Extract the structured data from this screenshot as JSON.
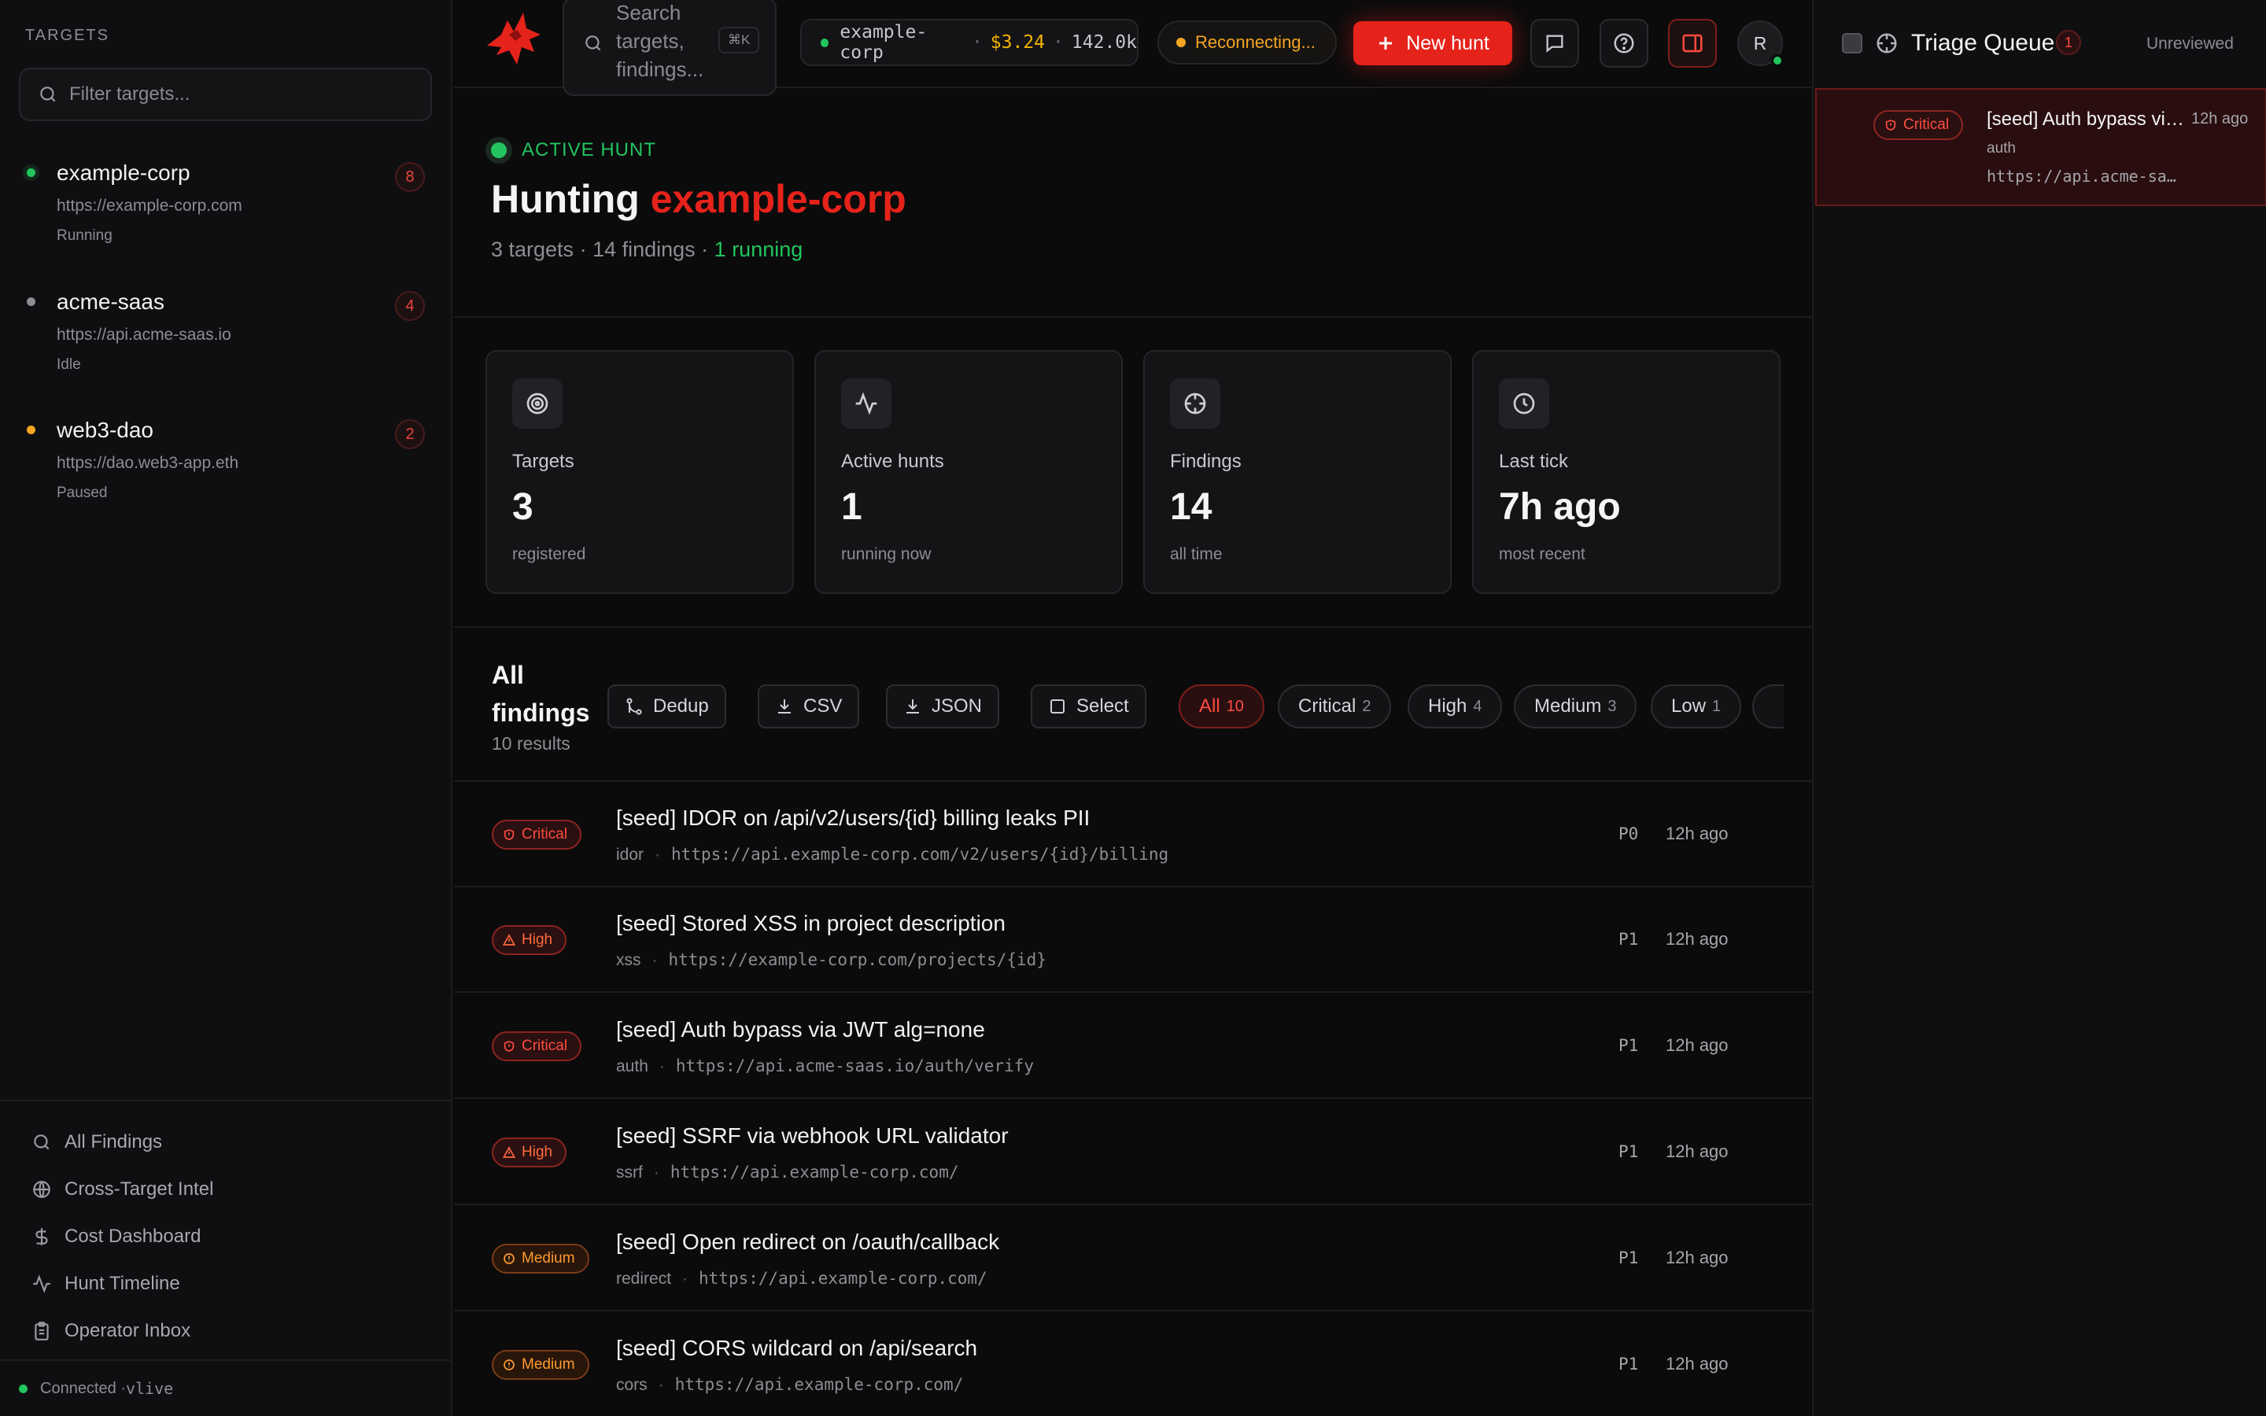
{
  "sidebar": {
    "section_title": "TARGETS",
    "filter_placeholder": "Filter targets...",
    "targets": [
      {
        "name": "example-corp",
        "url": "https://example-corp.com",
        "status": "Running",
        "count": "8",
        "dot_color": "#22c55e"
      },
      {
        "name": "acme-saas",
        "url": "https://api.acme-saas.io",
        "status": "Idle",
        "count": "4",
        "dot_color": "#8d8d94"
      },
      {
        "name": "web3-dao",
        "url": "https://dao.web3-app.eth",
        "status": "Paused",
        "count": "2",
        "dot_color": "#f5a623"
      }
    ],
    "nav": [
      {
        "label": "All Findings",
        "icon": "search-icon"
      },
      {
        "label": "Cross-Target Intel",
        "icon": "globe-icon"
      },
      {
        "label": "Cost Dashboard",
        "icon": "dollar-icon"
      },
      {
        "label": "Hunt Timeline",
        "icon": "activity-icon"
      },
      {
        "label": "Operator Inbox",
        "icon": "clipboard-icon"
      }
    ],
    "footer": {
      "text": "Connected · ",
      "mode": "vlive"
    }
  },
  "topbar": {
    "search_placeholder": "Search targets, findings...",
    "search_shortcut": "⌘K",
    "status_target": "example-corp",
    "status_cost": "$3.24",
    "status_tokens": "142.0k",
    "connection_label": "Reconnecting...",
    "new_hunt_label": "New hunt",
    "avatar_initial": "R"
  },
  "hero": {
    "tag": "ACTIVE HUNT",
    "title_prefix": "Hunting ",
    "title_target": "example-corp",
    "sub_targets": "3 targets",
    "sub_findings": "14 findings",
    "sub_running": "1 running",
    "sep": " · "
  },
  "stats": [
    {
      "label": "Targets",
      "value": "3",
      "hint": "registered",
      "icon": "target-icon"
    },
    {
      "label": "Active hunts",
      "value": "1",
      "hint": "running now",
      "icon": "activity-icon"
    },
    {
      "label": "Findings",
      "value": "14",
      "hint": "all time",
      "icon": "crosshair-icon"
    },
    {
      "label": "Last tick",
      "value": "7h ago",
      "hint": "most recent",
      "icon": "clock-icon"
    }
  ],
  "findings": {
    "title": "All findings",
    "result_count": "10 results",
    "toolbar": {
      "dedup": "Dedup",
      "csv": "CSV",
      "json": "JSON",
      "select": "Select"
    },
    "chips": [
      {
        "label": "All",
        "n": "10",
        "active": true
      },
      {
        "label": "Critical",
        "n": "2"
      },
      {
        "label": "High",
        "n": "4"
      },
      {
        "label": "Medium",
        "n": "3"
      },
      {
        "label": "Low",
        "n": "1"
      }
    ],
    "rows": [
      {
        "severity": "Critical",
        "title": "[seed] IDOR on /api/v2/users/{id} billing leaks PII",
        "category": "idor",
        "url": "https://api.example-corp.com/v2/users/{id}/billing",
        "priority": "P0",
        "age": "12h ago"
      },
      {
        "severity": "High",
        "title": "[seed] Stored XSS in project description",
        "category": "xss",
        "url": "https://example-corp.com/projects/{id}",
        "priority": "P1",
        "age": "12h ago"
      },
      {
        "severity": "Critical",
        "title": "[seed] Auth bypass via JWT alg=none",
        "category": "auth",
        "url": "https://api.acme-saas.io/auth/verify",
        "priority": "P1",
        "age": "12h ago"
      },
      {
        "severity": "High",
        "title": "[seed] SSRF via webhook URL validator",
        "category": "ssrf",
        "url": "https://api.example-corp.com/",
        "priority": "P1",
        "age": "12h ago"
      },
      {
        "severity": "Medium",
        "title": "[seed] Open redirect on /oauth/callback",
        "category": "redirect",
        "url": "https://api.example-corp.com/",
        "priority": "P1",
        "age": "12h ago"
      },
      {
        "severity": "Medium",
        "title": "[seed] CORS wildcard on /api/search",
        "category": "cors",
        "url": "https://api.example-corp.com/",
        "priority": "P1",
        "age": "12h ago"
      }
    ]
  },
  "triage": {
    "title": "Triage Queue",
    "count": "1",
    "filter": "Unreviewed",
    "item": {
      "severity": "Critical",
      "title": "[seed] Auth bypass via JWT alg=none",
      "category": "auth",
      "url": "https://api.acme-saas.io/auth/verify",
      "age": "12h ago"
    }
  }
}
